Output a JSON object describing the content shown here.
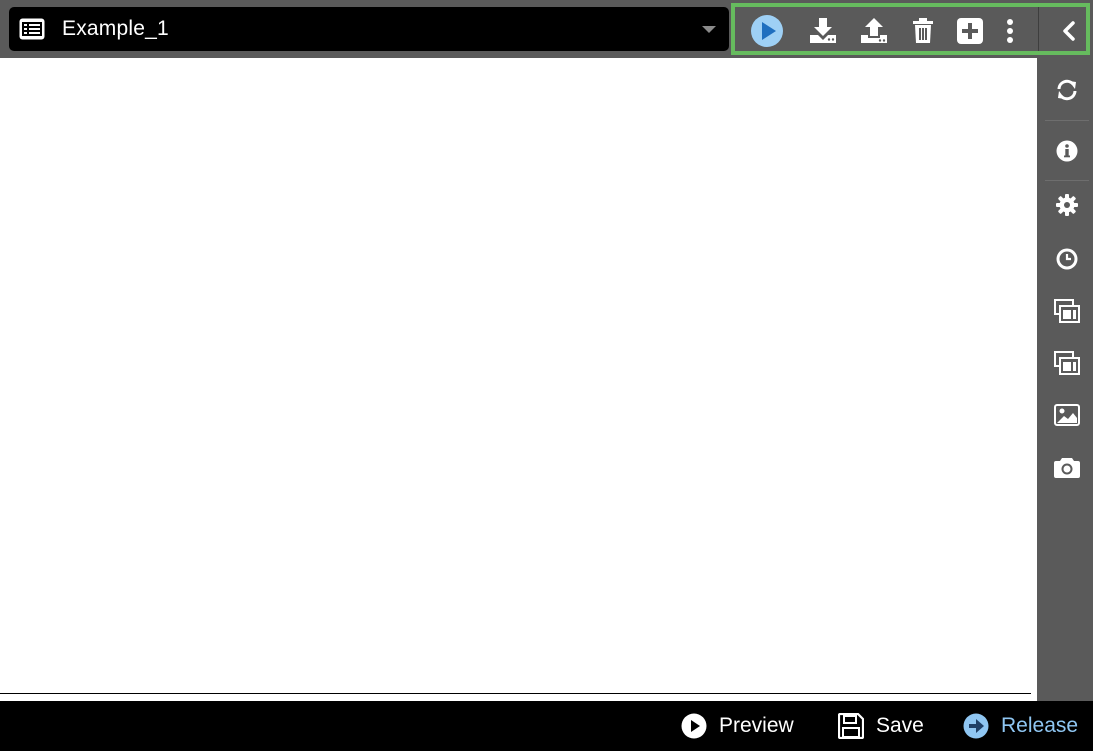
{
  "header": {
    "document_title": "Example_1",
    "list_icon": "list-icon",
    "dropdown_icon": "caret-down-icon"
  },
  "toolbar": {
    "highlight_color": "#66bb5e",
    "buttons": [
      {
        "name": "play-button",
        "icon": "play-circle-icon"
      },
      {
        "name": "download-button",
        "icon": "download-icon"
      },
      {
        "name": "upload-button",
        "icon": "upload-icon"
      },
      {
        "name": "delete-button",
        "icon": "trash-icon"
      },
      {
        "name": "add-button",
        "icon": "plus-square-icon"
      },
      {
        "name": "more-button",
        "icon": "vertical-ellipsis-icon"
      },
      {
        "name": "collapse-button",
        "icon": "chevron-left-icon"
      }
    ]
  },
  "sidebar": {
    "items": [
      {
        "name": "refresh",
        "icon": "refresh-icon"
      },
      {
        "name": "info",
        "icon": "info-icon"
      },
      {
        "name": "settings",
        "icon": "gear-icon"
      },
      {
        "name": "history",
        "icon": "clock-icon"
      },
      {
        "name": "layout-1",
        "icon": "window-layout-icon"
      },
      {
        "name": "layout-2",
        "icon": "window-layout-icon"
      },
      {
        "name": "image",
        "icon": "image-icon"
      },
      {
        "name": "snapshot",
        "icon": "camera-icon"
      }
    ]
  },
  "footer": {
    "preview_label": "Preview",
    "save_label": "Save",
    "release_label": "Release",
    "release_color": "#8fc6f2"
  }
}
